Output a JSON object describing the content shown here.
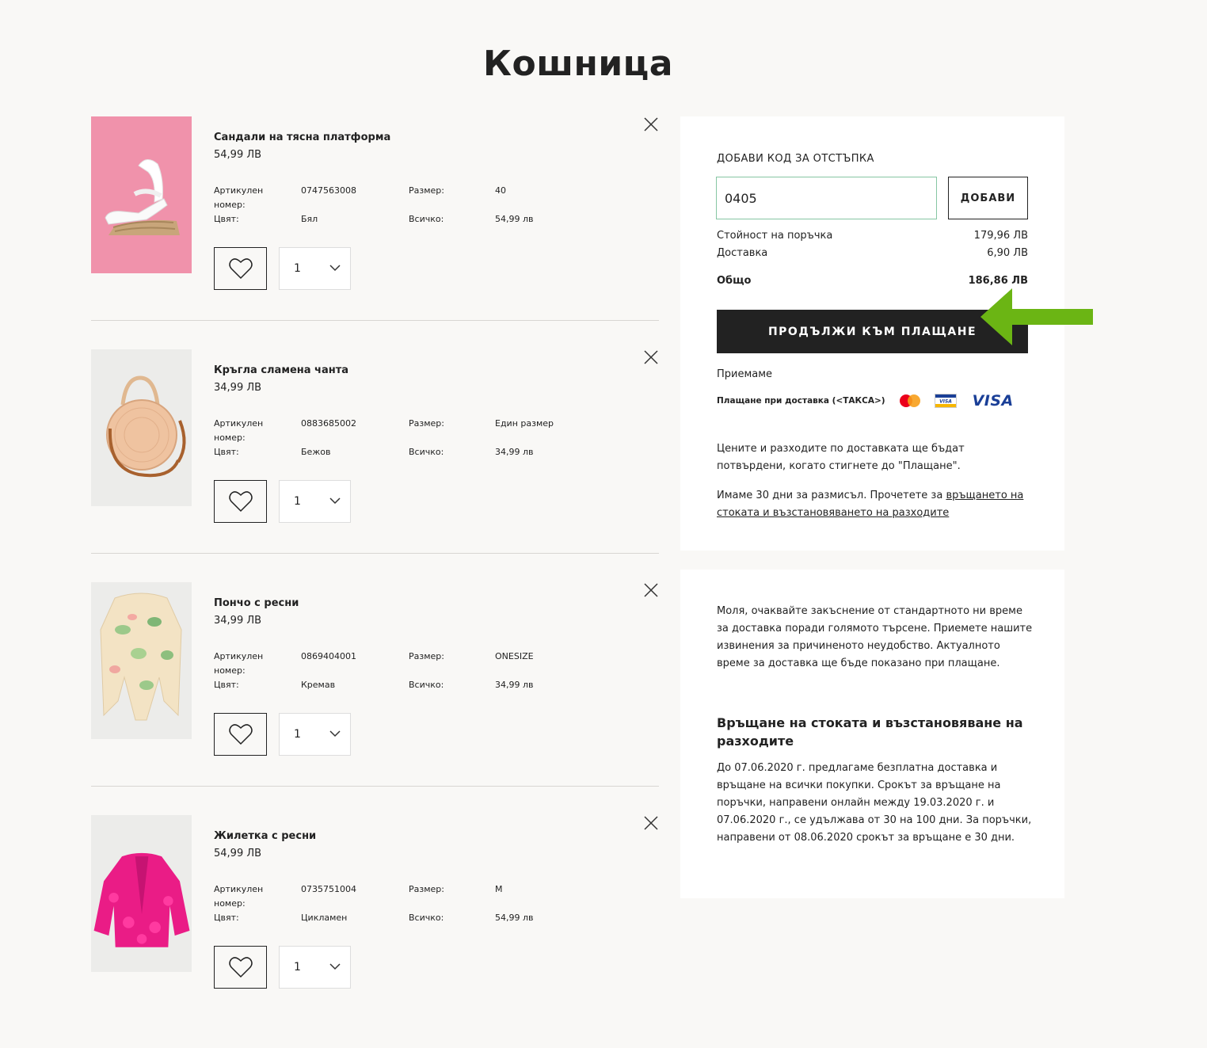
{
  "page_title": "Кошница",
  "labels": {
    "article": "Артикулен номер:",
    "color": "Цвят:",
    "size": "Размер:",
    "total": "Всичко:"
  },
  "items": [
    {
      "name": "Сандали на тясна платформа",
      "price": "54,99 ЛВ",
      "article": "0747563008",
      "color": "Бял",
      "size": "40",
      "total": "54,99 лв",
      "qty": "1"
    },
    {
      "name": "Кръгла сламена чанта",
      "price": "34,99 ЛВ",
      "article": "0883685002",
      "color": "Бежов",
      "size": "Един размер",
      "total": "34,99 лв",
      "qty": "1"
    },
    {
      "name": "Пончо с ресни",
      "price": "34,99 ЛВ",
      "article": "0869404001",
      "color": "Кремав",
      "size": "ONESIZE",
      "total": "34,99 лв",
      "qty": "1"
    },
    {
      "name": "Жилетка с ресни",
      "price": "54,99 ЛВ",
      "article": "0735751004",
      "color": "Цикламен",
      "size": "M",
      "total": "54,99 лв",
      "qty": "1"
    }
  ],
  "summary": {
    "discount_label": "ДОБАВИ КОД ЗА ОТСТЪПКА",
    "discount_value": "0405",
    "discount_button": "ДОБАВИ",
    "order_value_label": "Стойност на поръчка",
    "order_value": "179,96 ЛВ",
    "delivery_label": "Доставка",
    "delivery_value": "6,90 ЛВ",
    "total_label": "Общо",
    "total_value": "186,86 ЛВ",
    "checkout_button": "ПРОДЪЛЖИ КЪМ ПЛАЩАНЕ",
    "accept_label": "Приемаме",
    "cod_label": "Плащане при доставка (<ТАКСА>)",
    "visa_text": "VISA",
    "visa_small_text": "VISA",
    "note1": "Цените и разходите по доставката ще бъдат потвърдени, когато стигнете до \"Плащане\".",
    "note2_text": "Имаме 30 дни за размисъл. Прочетете за ",
    "note2_link": "връщането на стоката и възстановяването на разходите"
  },
  "info": {
    "delay_text": "Моля, очаквайте закъснение от стандартното ни време за доставка поради голямото търсене. Приемете нашите извинения за причиненото неудобство. Актуалното време за доставка ще бъде показано при плащане.",
    "returns_title": "Връщане на стоката и възстановяване на разходите",
    "returns_text": "До 07.06.2020 г. предлагаме безплатна доставка и връщане на всички покупки. Срокът за връщане на поръчки, направени онлайн между 19.03.2020 г. и 07.06.2020 г., се удължава от 30 на 100 дни. За поръчки, направени от 08.06.2020 срокът за връщане е 30 дни."
  },
  "colors": {
    "accent_arrow": "#6bb514",
    "checkout_bg": "#222222",
    "input_border": "#86c6a3",
    "visa_blue": "#1a3f97"
  }
}
